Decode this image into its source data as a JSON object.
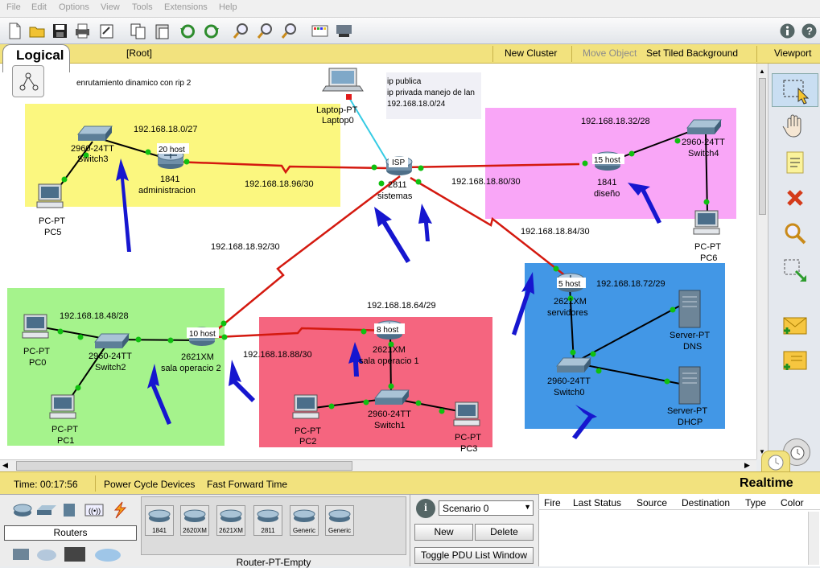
{
  "menu": [
    "File",
    "Edit",
    "Options",
    "View",
    "Tools",
    "Extensions",
    "Help"
  ],
  "logicalbar": {
    "tab": "Logical",
    "root": "[Root]",
    "new_cluster": "New Cluster",
    "move_object": "Move Object",
    "set_tiled_bg": "Set Tiled Background",
    "viewport": "Viewport"
  },
  "canvas": {
    "title_note": "enrutamiento dinamico  con rip 2",
    "note_lines": [
      "ip publica",
      "ip privada manejo de lan",
      "192.168.18.0/24"
    ],
    "laptop": {
      "model": "Laptop-PT",
      "name": "Laptop0"
    },
    "isp": {
      "badge": "ISP",
      "model": "2811",
      "name": "sistemas"
    },
    "r_admin": {
      "badge": "20 host",
      "model": "1841",
      "name": "administracion"
    },
    "r_diseno": {
      "badge": "15 host",
      "model": "1841",
      "name": "diseño"
    },
    "r_serv": {
      "badge": "5 host",
      "model": "2621XM",
      "name": "servidores"
    },
    "r_sala": {
      "badge": "10 host",
      "model": "2621XM",
      "name": "sala operacio 2"
    },
    "r_op1": {
      "badge": "8 host",
      "model": "2621XM",
      "name": "sala operacio 1"
    },
    "sw3": {
      "model": "2960-24TT",
      "name": "Switch3"
    },
    "sw4": {
      "model": "2960-24TT",
      "name": "Switch4"
    },
    "sw2": {
      "model": "2960-24TT",
      "name": "Switch2"
    },
    "sw1": {
      "model": "2960-24TT",
      "name": "Switch1"
    },
    "sw0": {
      "model": "2960-24TT",
      "name": "Switch0"
    },
    "pc5": {
      "model": "PC-PT",
      "name": "PC5"
    },
    "pc6": {
      "model": "PC-PT",
      "name": "PC6"
    },
    "pc0": {
      "model": "PC-PT",
      "name": "PC0"
    },
    "pc1": {
      "model": "PC-PT",
      "name": "PC1"
    },
    "pc2": {
      "model": "PC-PT",
      "name": "PC2"
    },
    "pc3": {
      "model": "PC-PT",
      "name": "PC3"
    },
    "dns": {
      "model": "Server-PT",
      "name": "DNS"
    },
    "dhcp": {
      "model": "Server-PT",
      "name": "DHCP"
    },
    "nets": {
      "n0": "192.168.18.0/27",
      "n32": "192.168.18.32/28",
      "n96": "192.168.18.96/30",
      "n80": "192.168.18.80/30",
      "n84": "192.168.18.84/30",
      "n92": "192.168.18.92/30",
      "n72": "192.168.18.72/29",
      "n48": "192.168.18.48/28",
      "n64": "192.168.18.64/29",
      "n88": "192.168.18.88/30"
    },
    "colors": {
      "yellow": "#fbf77f",
      "pink": "#f9a6f7",
      "green": "#a5f38c",
      "red": "#f5657f",
      "blue": "#4297e6",
      "link_red": "#d4190f",
      "link_black": "#000000",
      "laptop_link": "#36cbe4",
      "port_green": "#10c010"
    }
  },
  "status": {
    "time_label": "Time: 00:17:56",
    "power": "Power Cycle Devices",
    "fast": "Fast Forward Time",
    "mode": "Realtime"
  },
  "bottom": {
    "category": "Routers",
    "devices": [
      "1841",
      "2620XM",
      "2621XM",
      "2811",
      "Generic",
      "Generic"
    ],
    "selected_model": "Router-PT-Empty",
    "scenario": "Scenario 0",
    "new": "New",
    "delete": "Delete",
    "toggle": "Toggle PDU List Window",
    "columns": [
      "Fire",
      "Last Status",
      "Source",
      "Destination",
      "Type",
      "Color"
    ]
  }
}
